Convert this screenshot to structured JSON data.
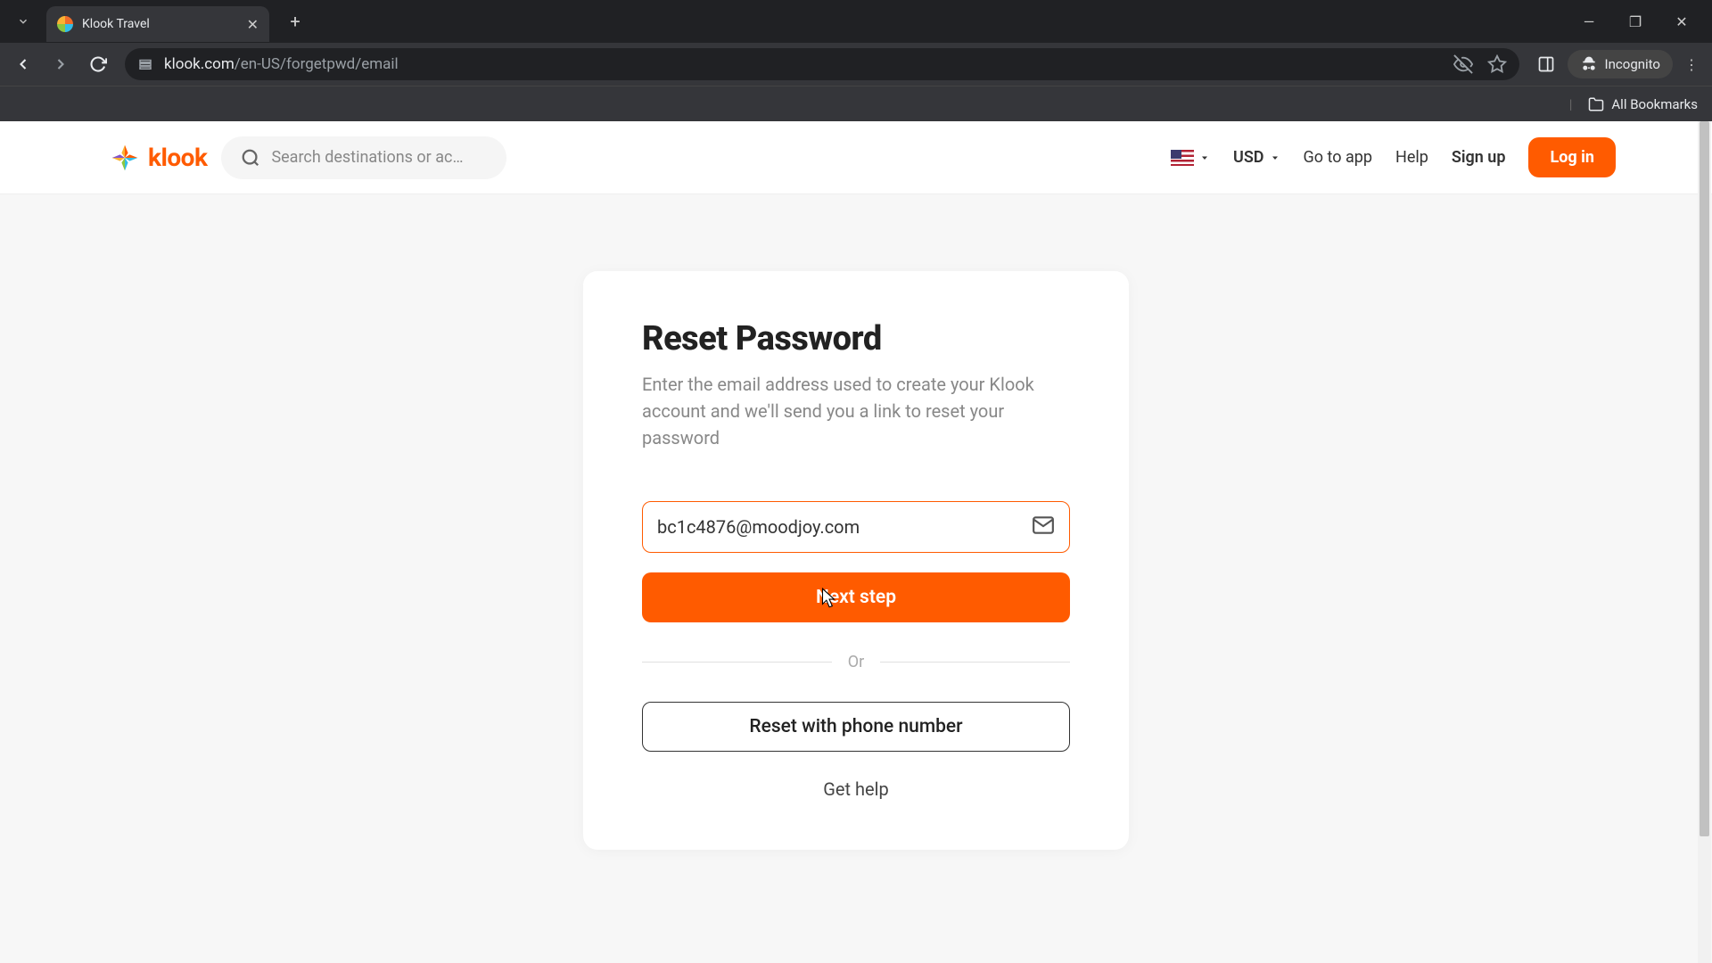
{
  "browser": {
    "tab_title": "Klook Travel",
    "url_domain": "klook.com",
    "url_path": "/en-US/forgetpwd/email",
    "incognito_label": "Incognito",
    "bookmarks_label": "All Bookmarks"
  },
  "header": {
    "logo_text": "klook",
    "search_placeholder": "Search destinations or ac…",
    "currency": "USD",
    "go_to_app": "Go to app",
    "help": "Help",
    "sign_up": "Sign up",
    "log_in": "Log in"
  },
  "reset": {
    "title": "Reset Password",
    "description": "Enter the email address used to create your Klook account and we'll send you a link to reset your password",
    "email_value": "bc1c4876@moodjoy.com",
    "next_step": "Next step",
    "or": "Or",
    "reset_phone": "Reset with phone number",
    "get_help": "Get help"
  }
}
